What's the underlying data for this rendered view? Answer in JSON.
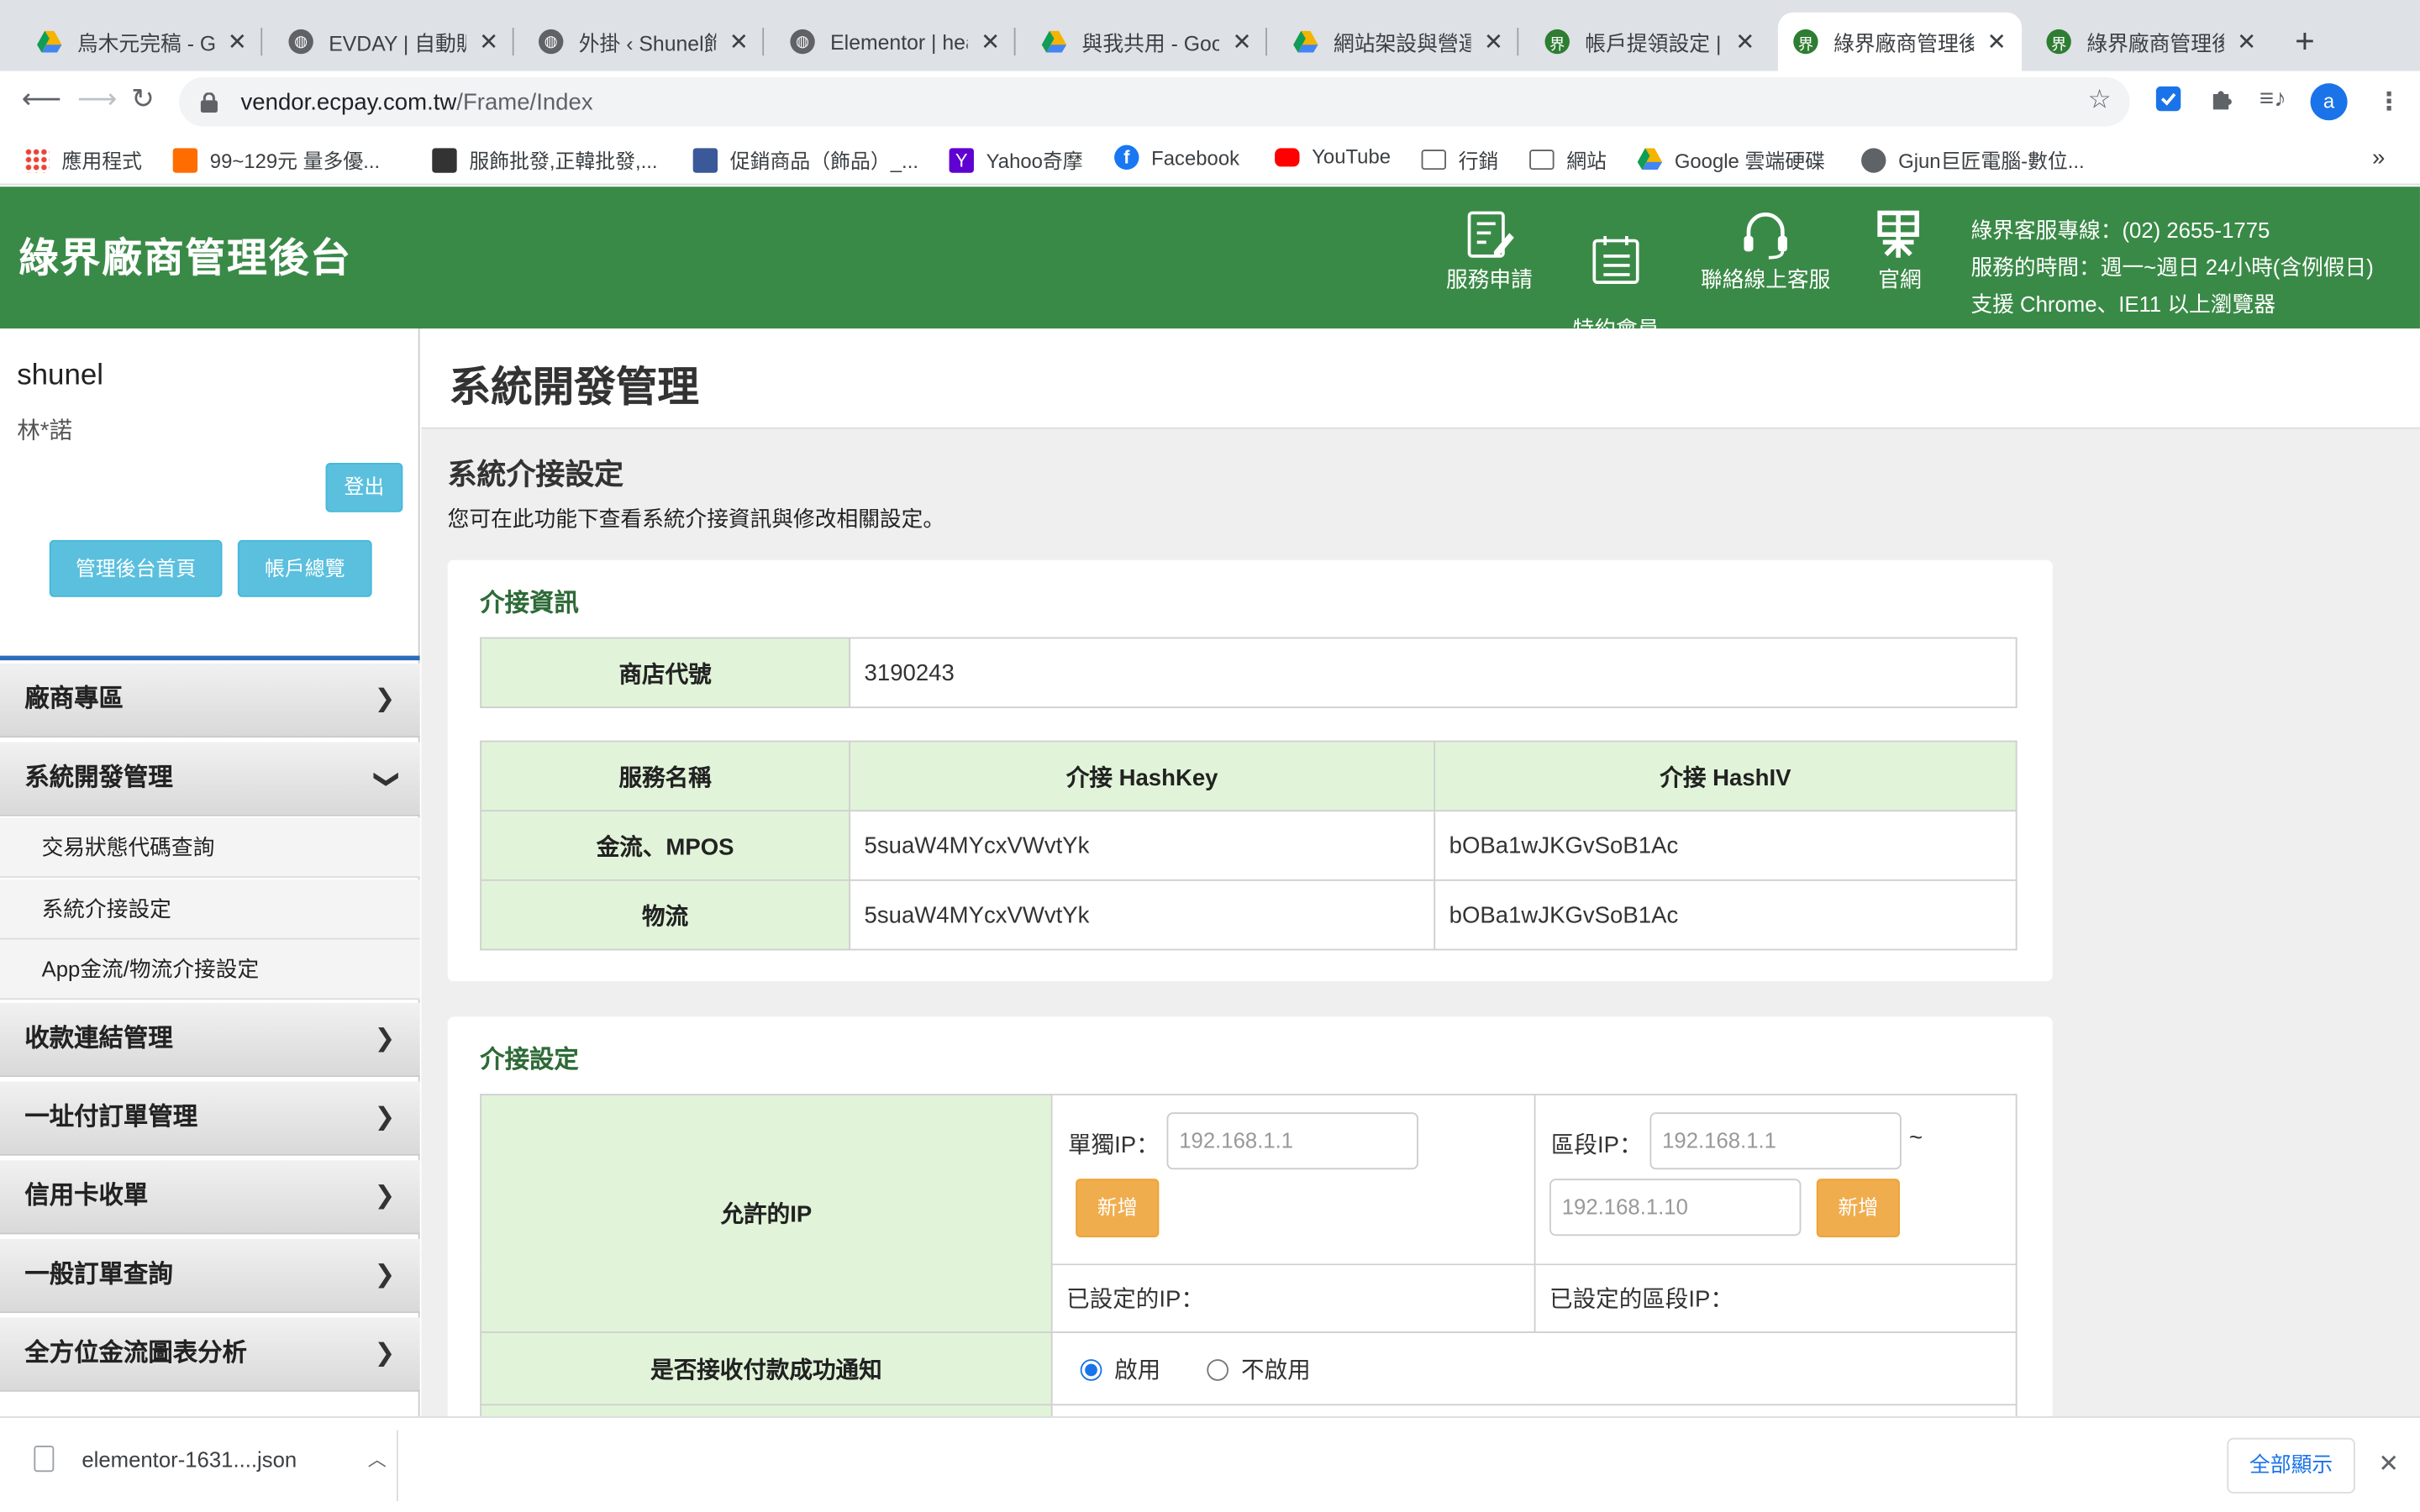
{
  "browser": {
    "tabs": [
      {
        "title": "烏木元完稿 - Go",
        "color": "#f4b400"
      },
      {
        "title": "EVDAY | 自動販",
        "color": "#5f6368"
      },
      {
        "title": "外掛 ‹ Shunel飾",
        "color": "#5f6368"
      },
      {
        "title": "Elementor | hea",
        "color": "#5f6368"
      },
      {
        "title": "與我共用 - Goo",
        "color": "#0f9d58"
      },
      {
        "title": "網站架設與營運",
        "color": "#f4b400"
      },
      {
        "title": "帳戶提領設定 |",
        "color": "#2e7d32"
      },
      {
        "title": "綠界廠商管理後",
        "color": "#2e7d32"
      },
      {
        "title": "綠界廠商管理後",
        "color": "#2e7d32"
      }
    ],
    "new_tab": "+",
    "url_host": "vendor.ecpay.com.tw",
    "url_path": "/Frame/Index",
    "avatar_letter": "a",
    "bookmarks": [
      {
        "label": "應用程式",
        "color": "#ea4335"
      },
      {
        "label": "99~129元 量多優...",
        "color": "#ff6d00"
      },
      {
        "label": "服飾批發,正韓批發,...",
        "color": "#333333"
      },
      {
        "label": "促銷商品（飾品）_...",
        "color": "#3b5998"
      },
      {
        "label": "Yahoo奇摩",
        "color": "#5f01d1"
      },
      {
        "label": "Facebook",
        "color": "#1877f2"
      },
      {
        "label": "YouTube",
        "color": "#ff0000"
      },
      {
        "label": "行銷",
        "color": "#5f6368"
      },
      {
        "label": "網站",
        "color": "#5f6368"
      },
      {
        "label": "Google 雲端硬碟",
        "color": "#0f9d58"
      },
      {
        "label": "Gjun巨匠電腦-數位...",
        "color": "#5f6368"
      }
    ],
    "bookmarks_more": "»"
  },
  "header": {
    "brand": "綠界廠商管理後台",
    "icons": [
      {
        "label": "服務申請"
      },
      {
        "label": "特約會員\n合約商議"
      },
      {
        "label": "聯絡線上客服"
      },
      {
        "label": "官網"
      }
    ],
    "info_line1": "綠界客服專線：(02) 2655-1775",
    "info_line2": "服務的時間：週一~週日 24小時(含例假日)",
    "info_line3": "支援 Chrome、IE11 以上瀏覽器"
  },
  "sidebar": {
    "username": "shunel",
    "masked_name": "林*諾",
    "logout": "登出",
    "home_button": "管理後台首頁",
    "overview_button": "帳戶總覽",
    "menu": [
      {
        "label": "廠商專區",
        "expanded": false
      },
      {
        "label": "系統開發管理",
        "expanded": true
      },
      {
        "label": "收款連結管理",
        "expanded": false
      },
      {
        "label": "一址付訂單管理",
        "expanded": false
      },
      {
        "label": "信用卡收單",
        "expanded": false
      },
      {
        "label": "一般訂單查詢",
        "expanded": false
      },
      {
        "label": "全方位金流圖表分析",
        "expanded": false
      }
    ],
    "submenu": [
      "交易狀態代碼查詢",
      "系統介接設定",
      "App金流/物流介接設定"
    ]
  },
  "main": {
    "page_title": "系統開發管理",
    "section_title": "系統介接設定",
    "section_desc": "您可在此功能下查看系統介接資訊與修改相關設定。",
    "info_panel": {
      "title": "介接資訊",
      "merchant_label": "商店代號",
      "merchant_id": "3190243",
      "headers": [
        "服務名稱",
        "介接 HashKey",
        "介接 HashIV"
      ],
      "rows": [
        {
          "service": "金流、MPOS",
          "hashkey": "5suaW4MYcxVWvtYk",
          "hashiv": "bOBa1wJKGvSoB1Ac"
        },
        {
          "service": "物流",
          "hashkey": "5suaW4MYcxVWvtYk",
          "hashiv": "bOBa1wJKGvSoB1Ac"
        }
      ]
    },
    "settings_panel": {
      "title": "介接設定",
      "allowed_ip_label": "允許的IP",
      "single_ip_label": "單獨IP：",
      "single_ip_placeholder": "192.168.1.1",
      "range_ip_label": "區段IP：",
      "range_start_placeholder": "192.168.1.1",
      "range_sep": "~",
      "range_end_placeholder": "192.168.1.10",
      "add_button": "新增",
      "configured_ip_label": "已設定的IP：",
      "configured_range_label": "已設定的區段IP：",
      "notify_label": "是否接收付款成功通知",
      "notify_options": [
        {
          "label": "啟用",
          "selected": true
        },
        {
          "label": "不啟用",
          "selected": false
        }
      ]
    }
  },
  "downloads": {
    "file": "elementor-1631....json",
    "show_all": "全部顯示",
    "close": "✕"
  }
}
